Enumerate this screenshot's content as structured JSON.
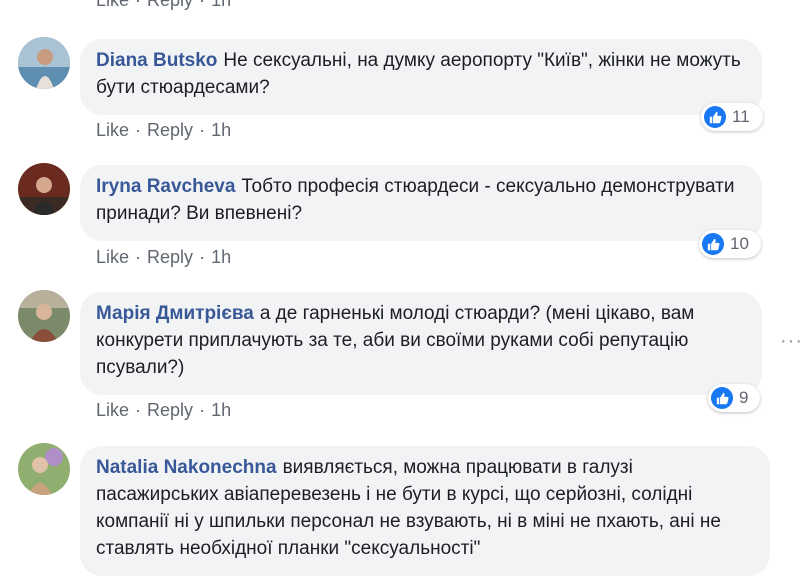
{
  "actions": {
    "like": "Like",
    "reply": "Reply",
    "separator": "·"
  },
  "top_partial": {
    "time": "1h"
  },
  "comments": [
    {
      "author": "Diana Butsko",
      "text": "Не сексуальні, на думку аеропорту \"Київ\", жінки не можуть бути стюардесами?",
      "likes": "11",
      "time": "1h"
    },
    {
      "author": "Iryna Ravcheva",
      "text": "Тобто професія стюардеси - сексуально демонструвати принади? Ви впевнені?",
      "likes": "10",
      "time": "1h"
    },
    {
      "author": "Марія Дмитрієва",
      "text": "а де гарненькі молоді стюарди? (мені цікаво, вам конкурети приплачують за те, аби ви своїми руками собі репутацію псували?)",
      "likes": "9",
      "time": "1h"
    },
    {
      "author": "Natalia Nakonechna",
      "text": "виявляється, можна працювати в галузі пасажирських авіаперевезень і не бути в курсі, що серйозні, солідні компанії ні у шпильки персонал не взувають, ні в міні не пхають, ані не ставлять необхідної планки \"сексуальності\"",
      "likes": "",
      "time": ""
    }
  ],
  "icons": {
    "like": "thumbs-up-icon",
    "more": "more-options-icon"
  },
  "colors": {
    "author": "#385898",
    "bubble": "#f2f3f5",
    "like_blue": "#1877f2",
    "meta": "#606770"
  }
}
